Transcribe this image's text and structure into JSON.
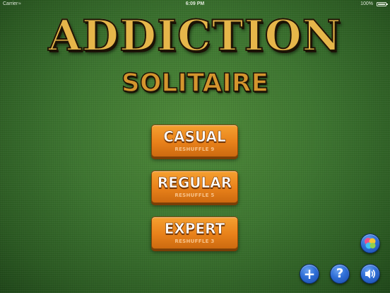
{
  "status_bar": {
    "carrier": "Carrier",
    "wifi_icon": "wifi-icon",
    "time": "6:09 PM",
    "battery_percent": "100%",
    "battery_icon": "battery-icon"
  },
  "title": {
    "main": "ADDICTION",
    "sub": "SOLITAIRE"
  },
  "modes": [
    {
      "label": "CASUAL",
      "sub": "RESHUFFLE 9"
    },
    {
      "label": "REGULAR",
      "sub": "RESHUFFLE 5"
    },
    {
      "label": "EXPERT",
      "sub": "RESHUFFLE 3"
    }
  ],
  "toolbar": {
    "gamecenter_icon": "game-center-icon",
    "add_glyph": "+",
    "help_glyph": "?",
    "sound_icon": "speaker-icon"
  },
  "colors": {
    "felt": "#3d7530",
    "button_orange": "#e8811a",
    "title_gold": "#e6b64a",
    "round_button_blue": "#2f6ed6"
  }
}
